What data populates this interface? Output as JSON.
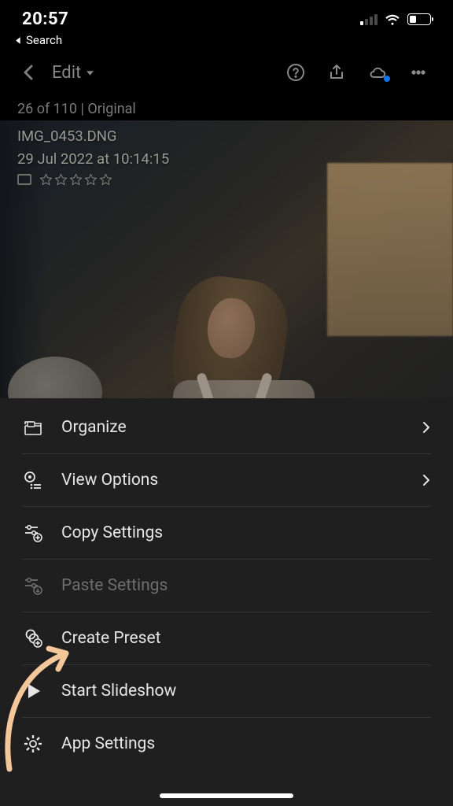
{
  "status_bar": {
    "time": "20:57",
    "back_app_label": "Search"
  },
  "toolbar": {
    "title": "Edit"
  },
  "info": {
    "position_line": "26 of 110 | Original"
  },
  "photo_meta": {
    "filename": "IMG_0453.DNG",
    "datetime": "29 Jul 2022 at 10:14:15",
    "rating": 0,
    "rating_max": 5
  },
  "sheet": {
    "organize": "Organize",
    "view_options": "View Options",
    "copy_settings": "Copy Settings",
    "paste_settings": "Paste Settings",
    "create_preset": "Create Preset",
    "start_slideshow": "Start Slideshow",
    "app_settings": "App Settings"
  }
}
